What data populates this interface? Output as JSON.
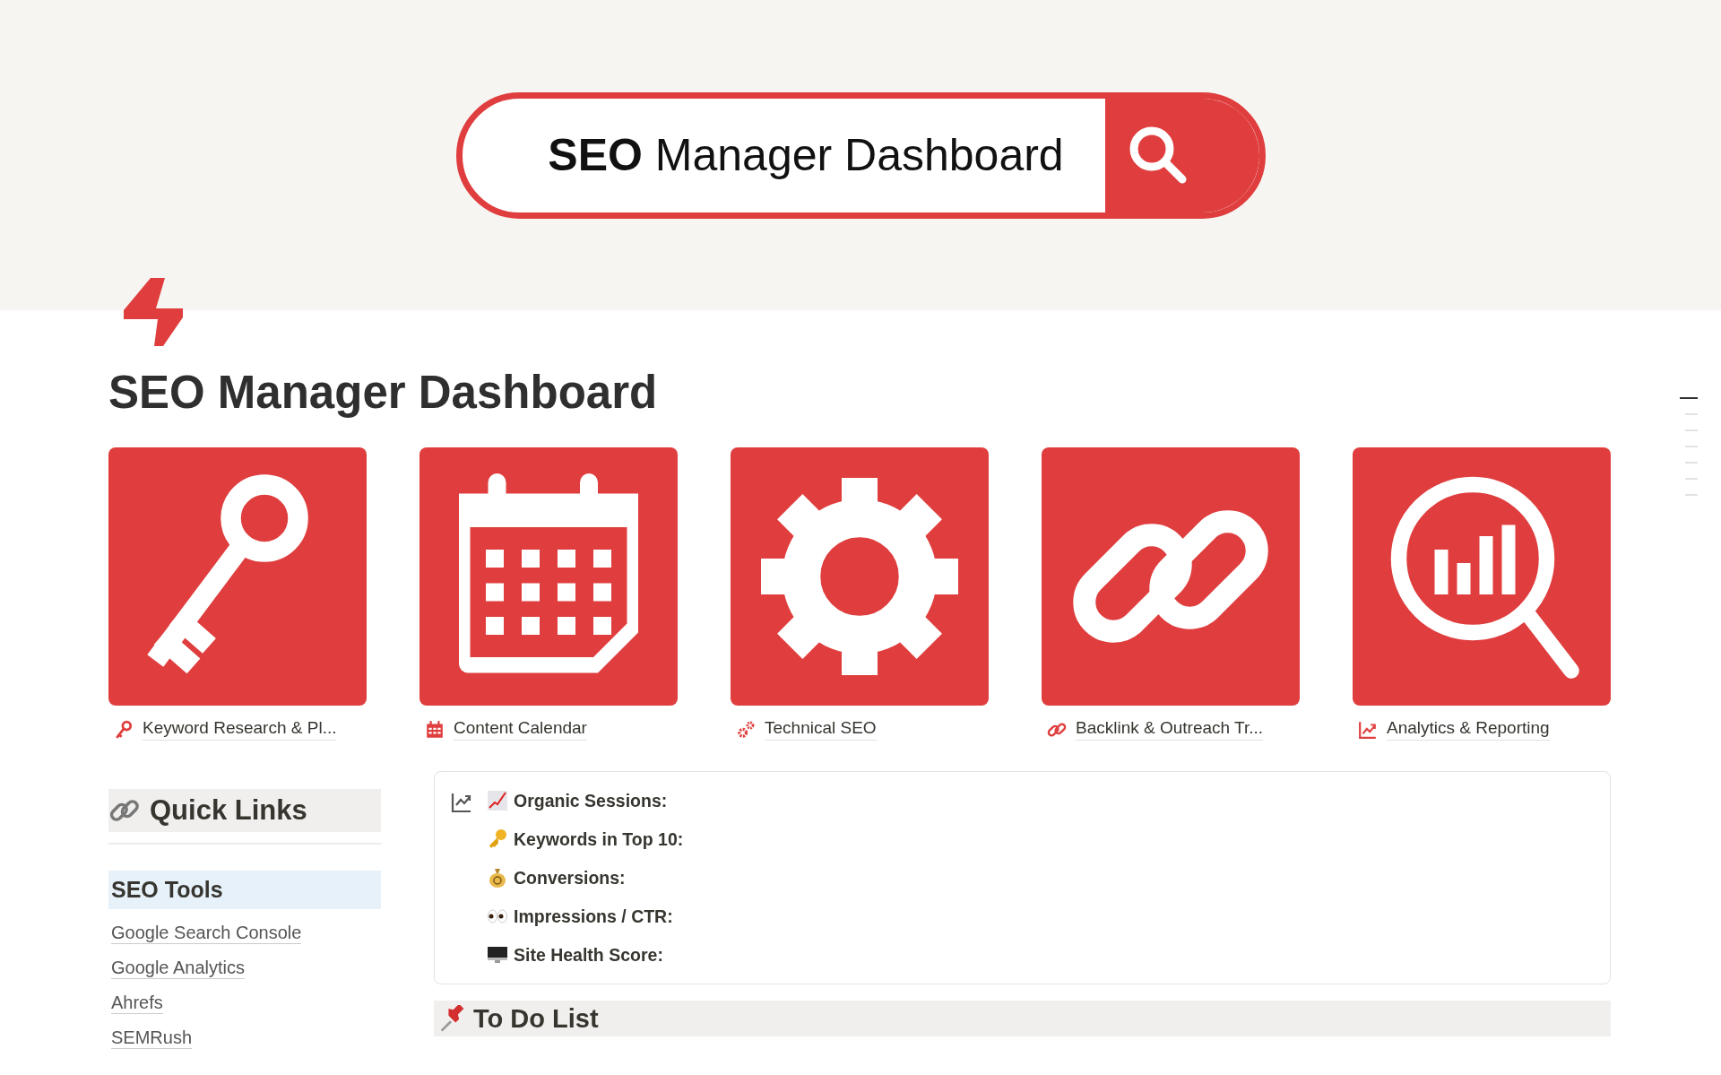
{
  "cover": {
    "search_title": "**SEO** Manager Dashboard"
  },
  "page_title": "SEO Manager Dashboard",
  "cards": [
    {
      "kind": "key",
      "label": "Keyword Research & Pl..."
    },
    {
      "kind": "calendar",
      "label": "Content Calendar"
    },
    {
      "kind": "gear",
      "label": "Technical SEO"
    },
    {
      "kind": "link",
      "label": "Backlink & Outreach Tr..."
    },
    {
      "kind": "analytics",
      "label": "Analytics & Reporting"
    }
  ],
  "quick_links": {
    "heading": "Quick Links",
    "section_title": "SEO Tools",
    "links": [
      "Google Search Console",
      "Google Analytics",
      "Ahrefs",
      "SEMRush"
    ]
  },
  "stats": [
    {
      "kind": "chart",
      "label": "Organic Sessions:"
    },
    {
      "kind": "key",
      "label": "Keywords in Top 10:"
    },
    {
      "kind": "money",
      "label": "Conversions:"
    },
    {
      "kind": "eyes",
      "label": "Impressions / CTR:"
    },
    {
      "kind": "monitor",
      "label": "Site Health Score:"
    }
  ],
  "todo": {
    "heading": "To Do List"
  }
}
